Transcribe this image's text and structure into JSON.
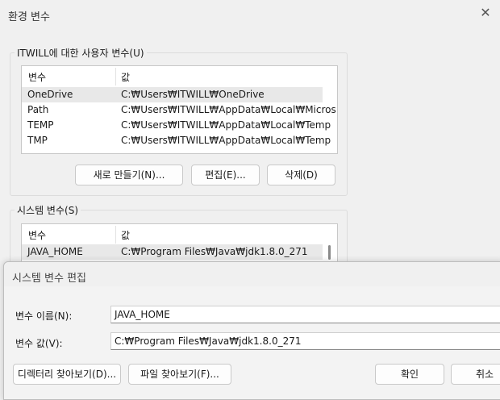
{
  "env_dialog": {
    "title": "환경 변수",
    "close_glyph": "✕",
    "user_group": {
      "label": "ITWILL에 대한 사용자 변수(U)",
      "columns": [
        "변수",
        "값"
      ],
      "rows": [
        {
          "name": "OneDrive",
          "value": "C:₩Users₩ITWILL₩OneDrive"
        },
        {
          "name": "Path",
          "value": "C:₩Users₩ITWILL₩AppData₩Local₩Micros..."
        },
        {
          "name": "TEMP",
          "value": "C:₩Users₩ITWILL₩AppData₩Local₩Temp"
        },
        {
          "name": "TMP",
          "value": "C:₩Users₩ITWILL₩AppData₩Local₩Temp"
        }
      ],
      "buttons": {
        "new": "새로 만들기(N)...",
        "edit": "편집(E)...",
        "delete": "삭제(D)"
      }
    },
    "system_group": {
      "label": "시스템 변수(S)",
      "columns": [
        "변수",
        "값"
      ],
      "rows": [
        {
          "name": "JAVA_HOME",
          "value": "C:₩Program Files₩Java₩jdk1.8.0_271"
        }
      ]
    }
  },
  "edit_dialog": {
    "title": "시스템 변수 편집",
    "name_label": "변수 이름(N):",
    "name_value": "JAVA_HOME",
    "value_label": "변수 값(V):",
    "value_value": "C:₩Program Files₩Java₩jdk1.8.0_271",
    "buttons": {
      "browse_dir": "디렉터리 찾아보기(D)...",
      "browse_file": "파일 찾아보기(F)...",
      "ok": "확인",
      "cancel": "취소"
    }
  },
  "colors": {
    "selected_row": "#e8e8e8",
    "background": "#f0f0f0"
  }
}
